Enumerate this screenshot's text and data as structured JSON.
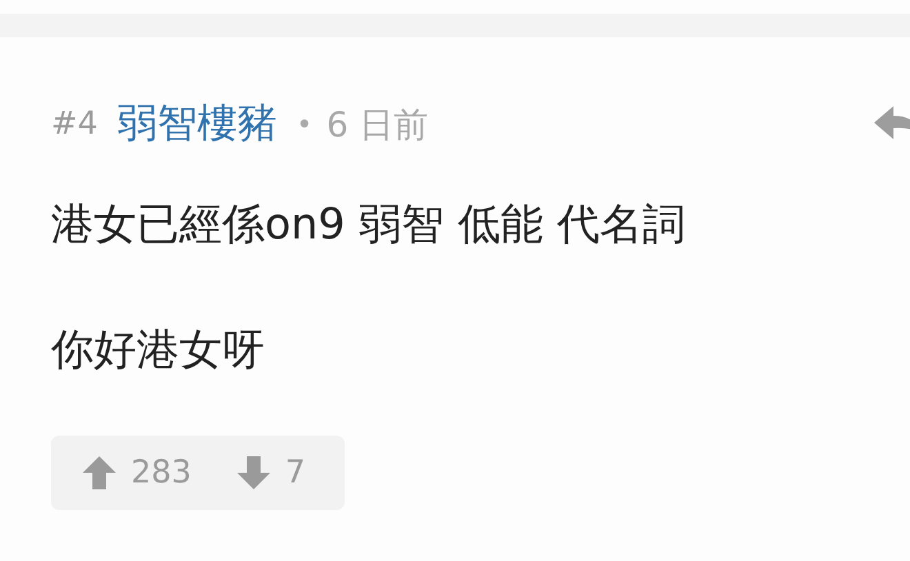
{
  "post": {
    "number": "#4",
    "author": "弱智樓豬",
    "separator": "•",
    "time": "6 日前",
    "body": [
      "港女已經係on9 弱智 低能 代名詞",
      "你好港女呀"
    ],
    "votes": {
      "up": "283",
      "down": "7"
    }
  }
}
